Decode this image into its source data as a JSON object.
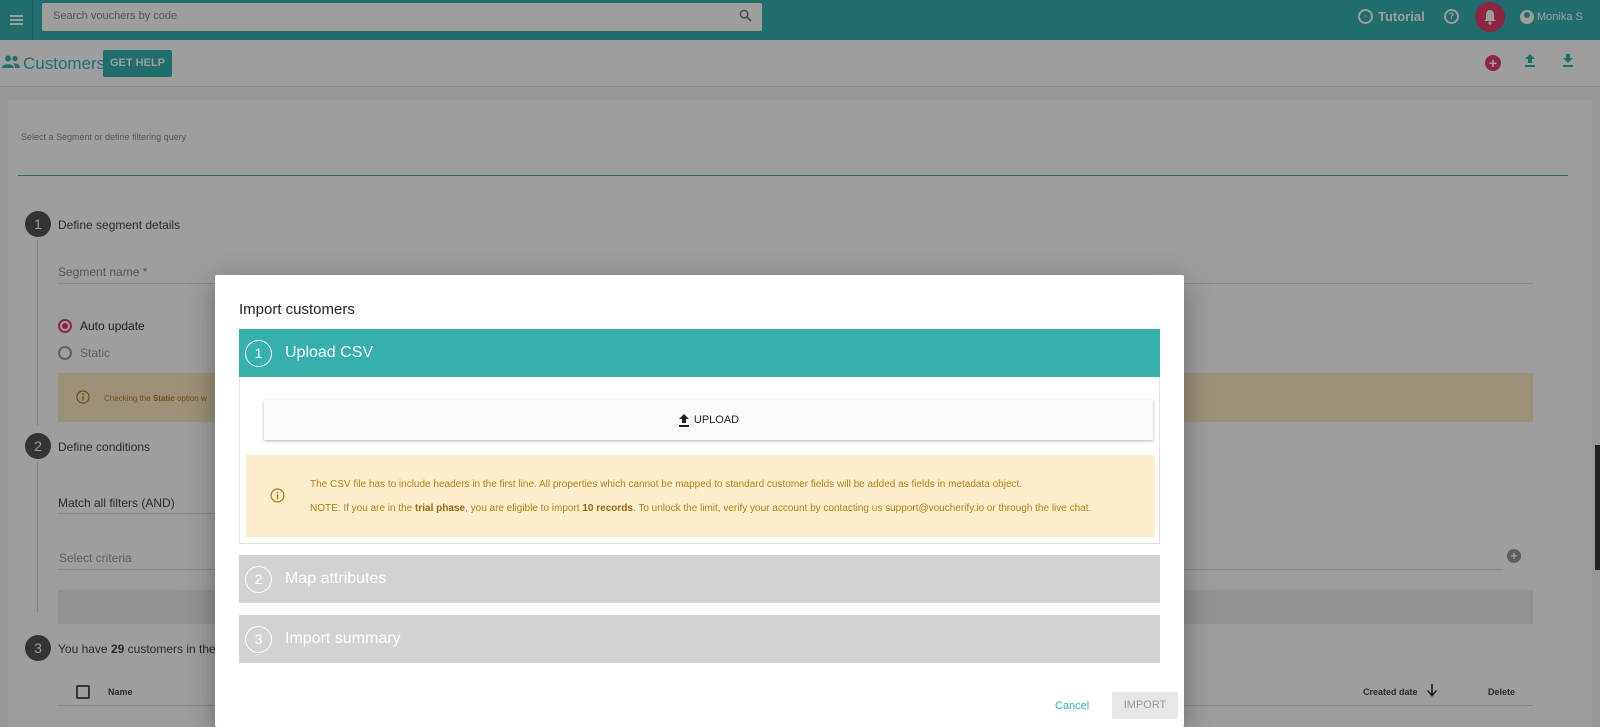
{
  "topbar": {
    "search_placeholder": "Search vouchers by code",
    "tutorial_label": "Tutorial",
    "user_name": "Monika S"
  },
  "page_header": {
    "title": "Customers",
    "get_help_label": "GET HELP"
  },
  "segment_form": {
    "segment_hint": "Select a Segment or define filtering query",
    "step1": {
      "number": "1",
      "label": "Define segment details"
    },
    "segment_name_label": "Segment name *",
    "radio_auto": "Auto update",
    "radio_static": "Static",
    "static_note_prefix": "Checking the ",
    "static_note_bold": "Static",
    "static_note_suffix": " option w",
    "step2": {
      "number": "2",
      "label": "Define conditions"
    },
    "match_label": "Match all filters (AND)",
    "criteria_placeholder": "Select criteria",
    "step3": {
      "number": "3",
      "label_prefix": "You have ",
      "count": "29",
      "label_suffix": " customers in the"
    },
    "table": {
      "col_name": "Name",
      "col_created": "Created date",
      "col_delete": "Delete"
    }
  },
  "modal": {
    "title": "Import customers",
    "steps": [
      {
        "number": "1",
        "label": "Upload CSV"
      },
      {
        "number": "2",
        "label": "Map attributes"
      },
      {
        "number": "3",
        "label": "Import summary"
      }
    ],
    "upload_label": "UPLOAD",
    "info_line1": "The CSV file has to include headers in the first line. All properties which cannot be mapped to standard customer fields will be added as fields in metadata object.",
    "info_line2": {
      "p1": "NOTE: If you are in the ",
      "b1": "trial phase",
      "p2": ", you are eligible to import ",
      "b2": "10 records",
      "p3": ". To unlock the limit, verify your account by contacting us support@voucherify.io or through the live chat."
    },
    "cancel_label": "Cancel",
    "import_label": "IMPORT"
  },
  "colors": {
    "accent": "#35b0ad",
    "pink": "#e63c6c",
    "warning_bg": "#fdefcd",
    "warning_text": "#b77d13"
  }
}
